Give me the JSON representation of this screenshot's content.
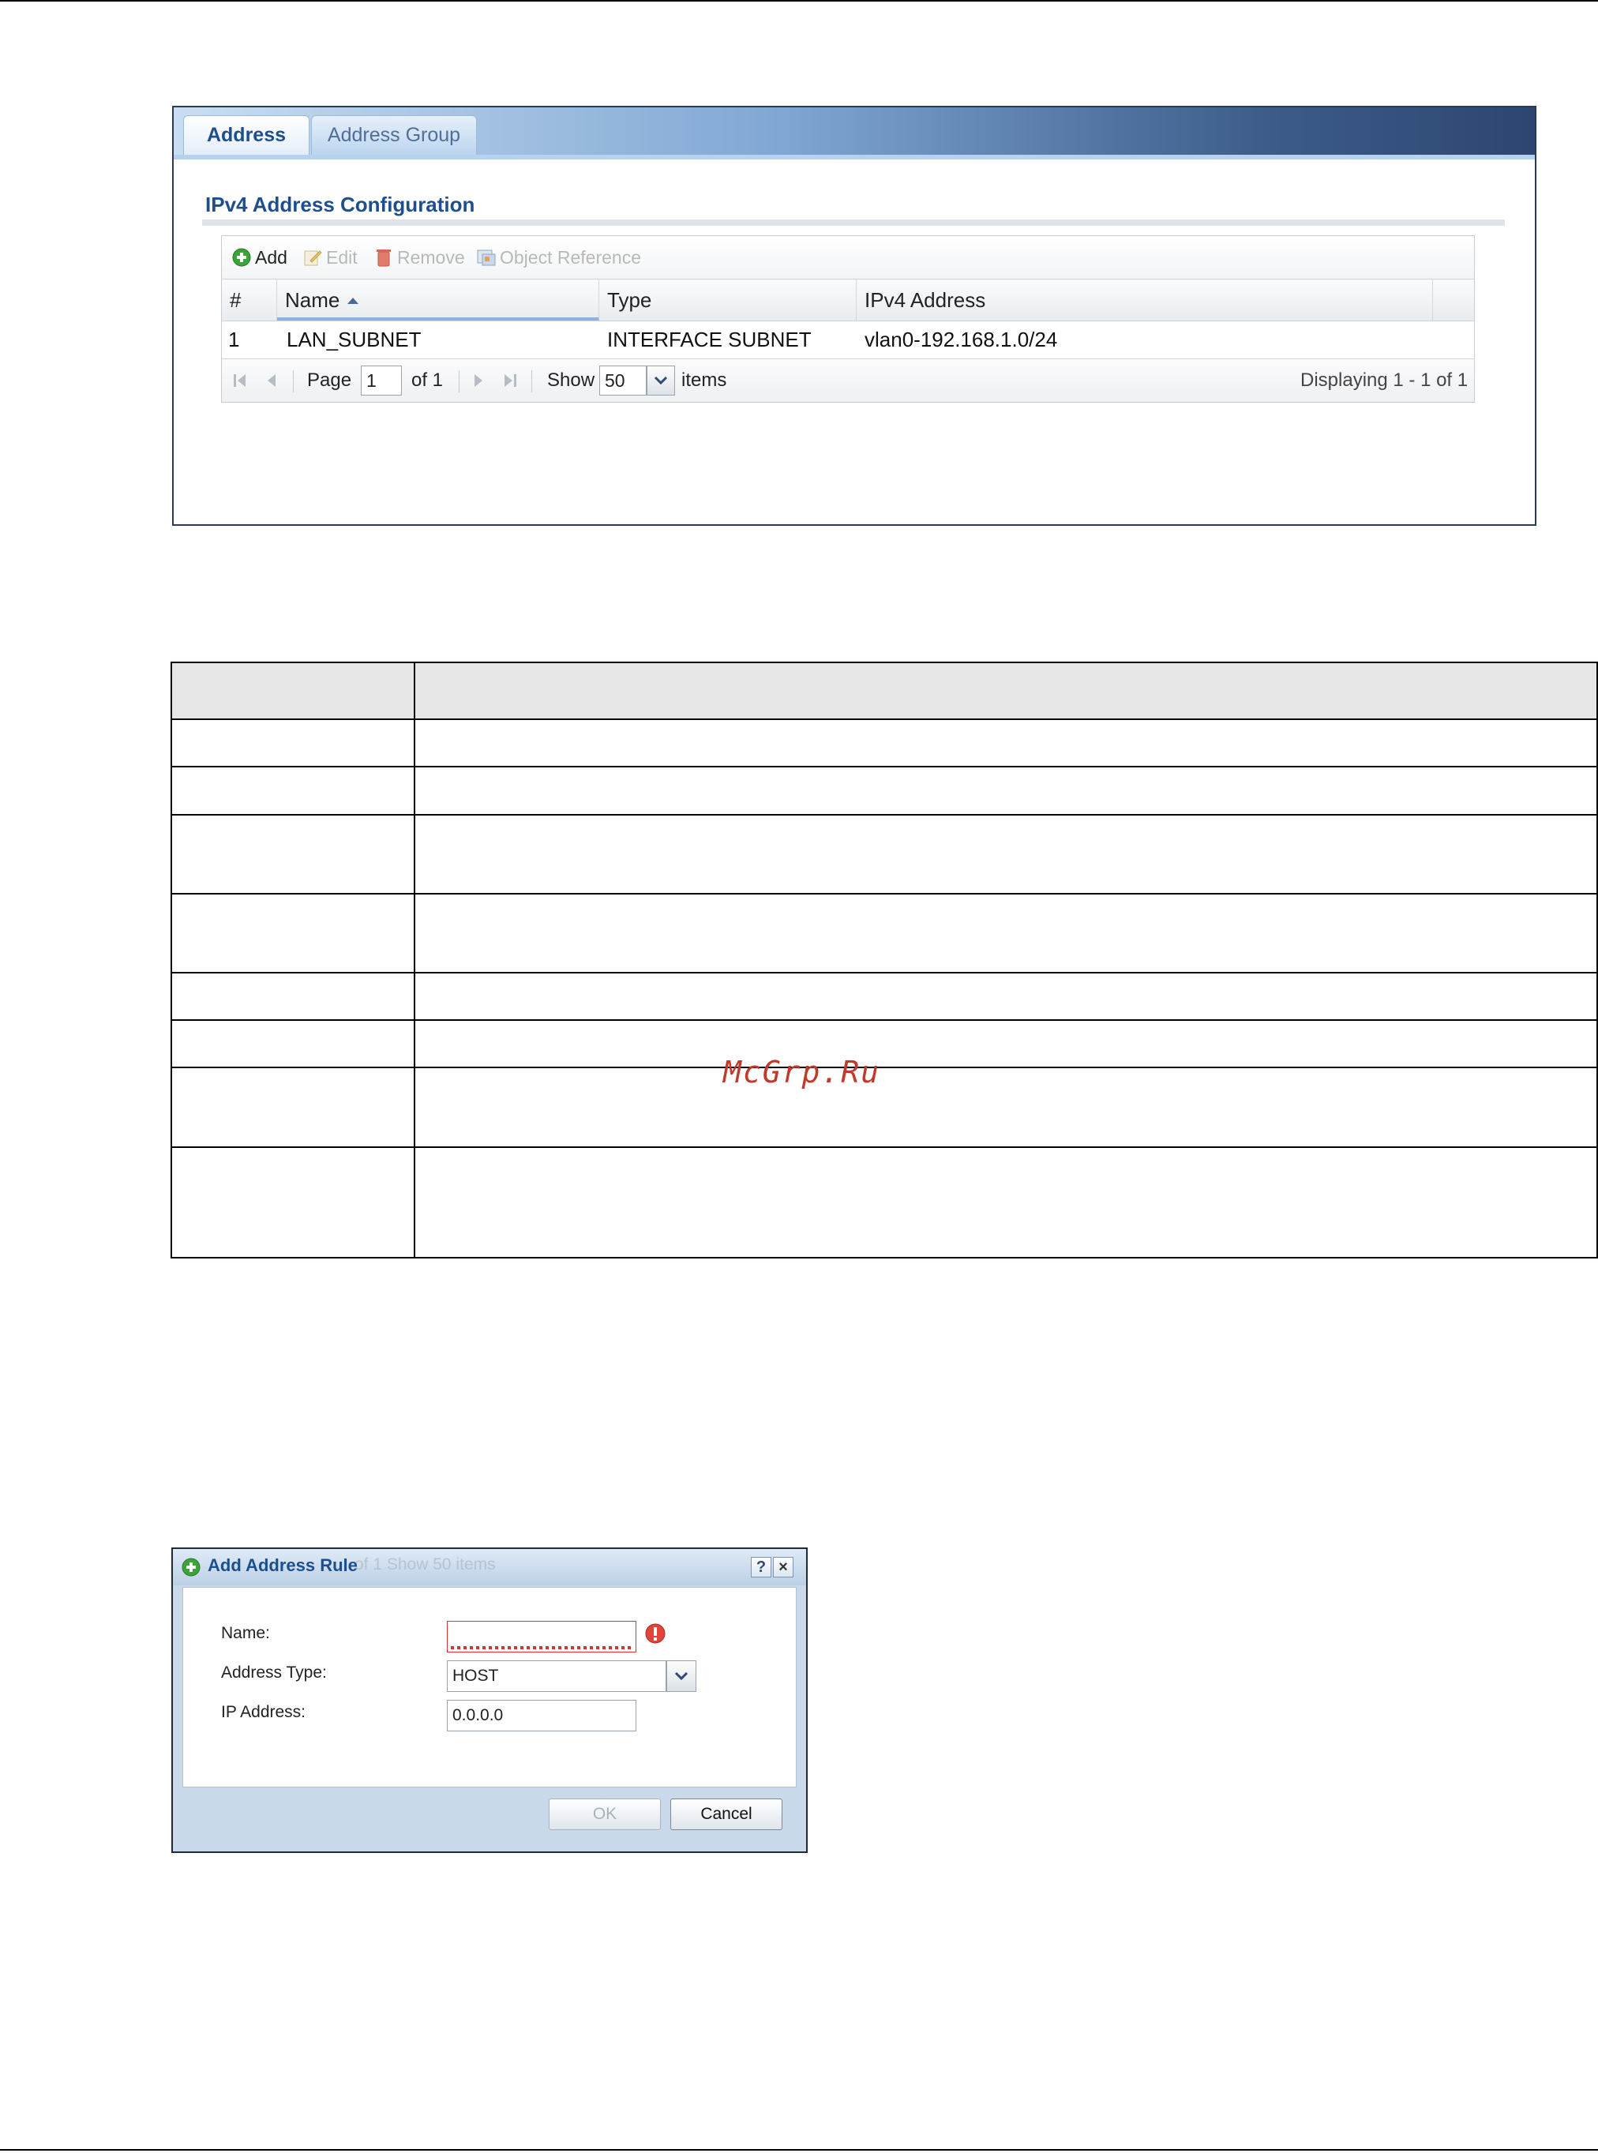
{
  "shot1": {
    "tabs": [
      "Address",
      "Address Group"
    ],
    "section_title": "IPv4 Address Configuration",
    "toolbar": {
      "add": "Add",
      "edit": "Edit",
      "remove": "Remove",
      "object_reference": "Object Reference",
      "icons": [
        "add-icon",
        "edit-icon",
        "remove-icon",
        "object-reference-icon"
      ]
    },
    "columns": [
      "#",
      "Name",
      "Type",
      "IPv4 Address"
    ],
    "rows": [
      {
        "num": "1",
        "name": "LAN_SUBNET",
        "type": "INTERFACE SUBNET",
        "ipv4": "vlan0-192.168.1.0/24"
      }
    ],
    "pager": {
      "page_label": "Page",
      "page_value": "1",
      "of_label": "of 1",
      "show_label": "Show",
      "show_value": "50",
      "items_label": "items",
      "displaying": "Displaying 1 - 1 of 1"
    }
  },
  "doc_table": {
    "rows": 9,
    "note": ""
  },
  "watermark": "McGrp.Ru",
  "dialog": {
    "title": "Add Address Rule",
    "background_ghost": "of 1      Show 50    items",
    "help_label": "?",
    "close_label": "×",
    "fields": {
      "name_label": "Name:",
      "name_value": "",
      "address_type_label": "Address Type:",
      "address_type_value": "HOST",
      "ip_address_label": "IP Address:",
      "ip_address_value": "0.0.0.0"
    },
    "buttons": {
      "ok": "OK",
      "cancel": "Cancel"
    }
  },
  "colors": {
    "accent": "#1d4f8f",
    "error": "#dd3333",
    "add_green": "#3aa33a"
  }
}
